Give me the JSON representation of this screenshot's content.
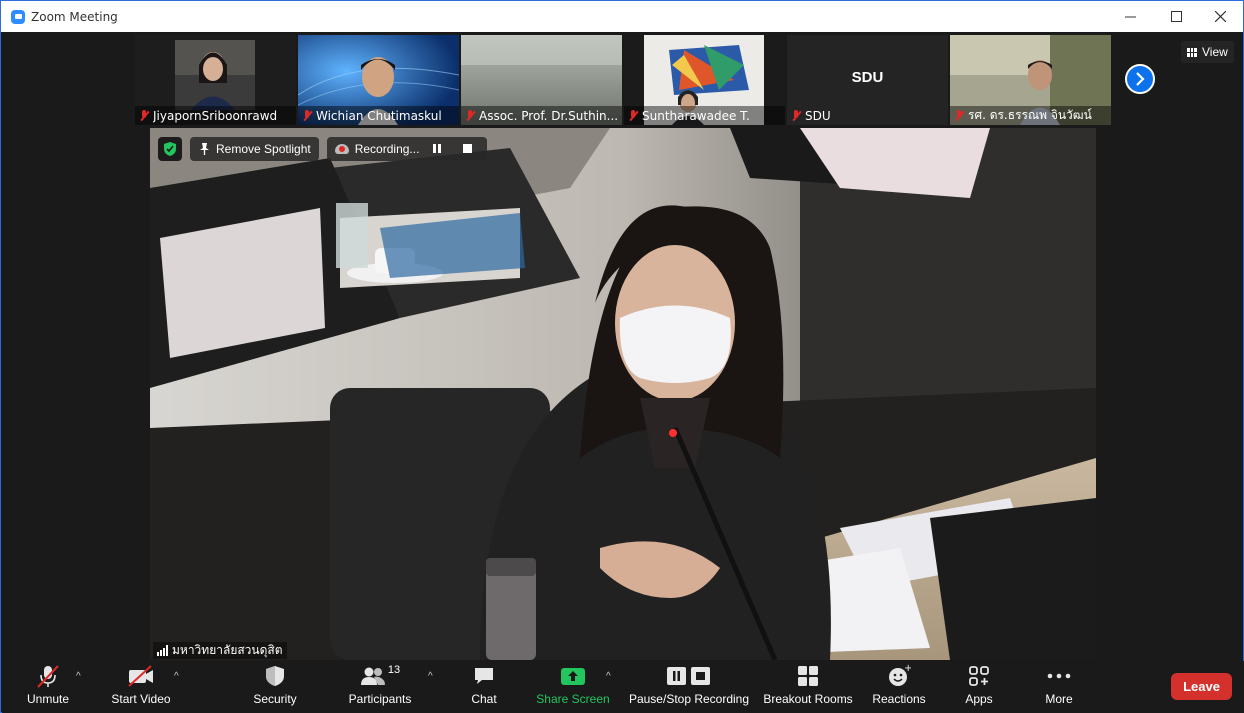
{
  "window": {
    "title": "Zoom Meeting",
    "minimize": "—",
    "maximize": "☐",
    "close": "✕"
  },
  "thumbnails": [
    {
      "name": "JiyapornSriboonrawd",
      "big_label": ""
    },
    {
      "name": "Wichian Chutimaskul",
      "big_label": ""
    },
    {
      "name": "Assoc. Prof. Dr.Suthin...",
      "big_label": ""
    },
    {
      "name": "Suntharawadee T.",
      "big_label": ""
    },
    {
      "name": "SDU",
      "big_label": "SDU"
    },
    {
      "name": "รศ. ดร.ธรรณพ จินวัฒน์",
      "big_label": ""
    }
  ],
  "view_button": "View",
  "overlay": {
    "remove_spotlight": "Remove Spotlight",
    "recording": "Recording..."
  },
  "speaker": {
    "name": "มหาวิทยาลัยสวนดุสิต"
  },
  "toolbar": {
    "unmute": "Unmute",
    "start_video": "Start Video",
    "security": "Security",
    "participants": "Participants",
    "participants_count": "13",
    "chat": "Chat",
    "share_screen": "Share Screen",
    "pause_stop_recording": "Pause/Stop Recording",
    "breakout_rooms": "Breakout Rooms",
    "reactions": "Reactions",
    "apps": "Apps",
    "more": "More",
    "leave": "Leave"
  },
  "colors": {
    "accent_blue": "#0e72ed",
    "share_green": "#22c55e",
    "leave_red": "#d4312c",
    "muted_red": "#e02828"
  }
}
